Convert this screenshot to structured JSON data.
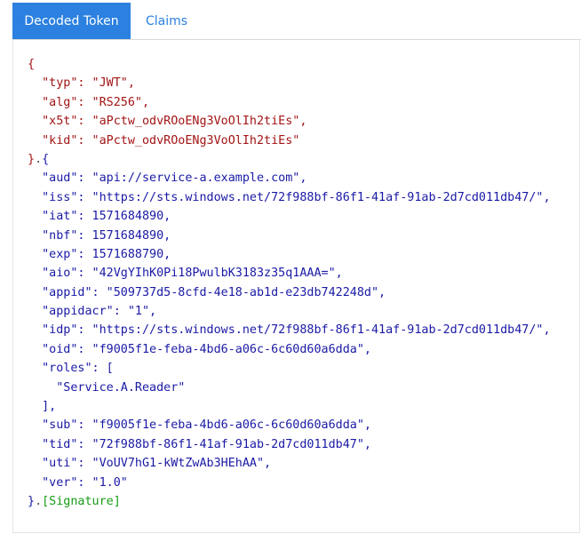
{
  "tabs": [
    {
      "label": "Decoded Token",
      "active": true
    },
    {
      "label": "Claims",
      "active": false
    }
  ],
  "colors": {
    "accent": "#2b80e0",
    "header_text": "#a31515",
    "payload_text": "#1a1aa6",
    "signature_text": "#169c16"
  },
  "token": {
    "header_lines": [
      "{",
      "  \"typ\": \"JWT\",",
      "  \"alg\": \"RS256\",",
      "  \"x5t\": \"aPctw_odvROoENg3VoOlIh2tiEs\",",
      "  \"kid\": \"aPctw_odvROoENg3VoOlIh2tiEs\""
    ],
    "header_close": "}",
    "separator": ".",
    "payload_open": "{",
    "payload_lines": [
      "  \"aud\": \"api://service-a.example.com\",",
      "  \"iss\": \"https://sts.windows.net/72f988bf-86f1-41af-91ab-2d7cd011db47/\",",
      "  \"iat\": 1571684890,",
      "  \"nbf\": 1571684890,",
      "  \"exp\": 1571688790,",
      "  \"aio\": \"42VgYIhK0Pi18PwulbK3183z35q1AAA=\",",
      "  \"appid\": \"509737d5-8cfd-4e18-ab1d-e23db742248d\",",
      "  \"appidacr\": \"1\",",
      "  \"idp\": \"https://sts.windows.net/72f988bf-86f1-41af-91ab-2d7cd011db47/\",",
      "  \"oid\": \"f9005f1e-feba-4bd6-a06c-6c60d60a6dda\",",
      "  \"roles\": [",
      "    \"Service.A.Reader\"",
      "  ],",
      "  \"sub\": \"f9005f1e-feba-4bd6-a06c-6c60d60a6dda\",",
      "  \"tid\": \"72f988bf-86f1-41af-91ab-2d7cd011db47\",",
      "  \"uti\": \"VoUV7hG1-kWtZwAb3HEhAA\",",
      "  \"ver\": \"1.0\""
    ],
    "payload_close": "}",
    "signature": "[Signature]"
  }
}
